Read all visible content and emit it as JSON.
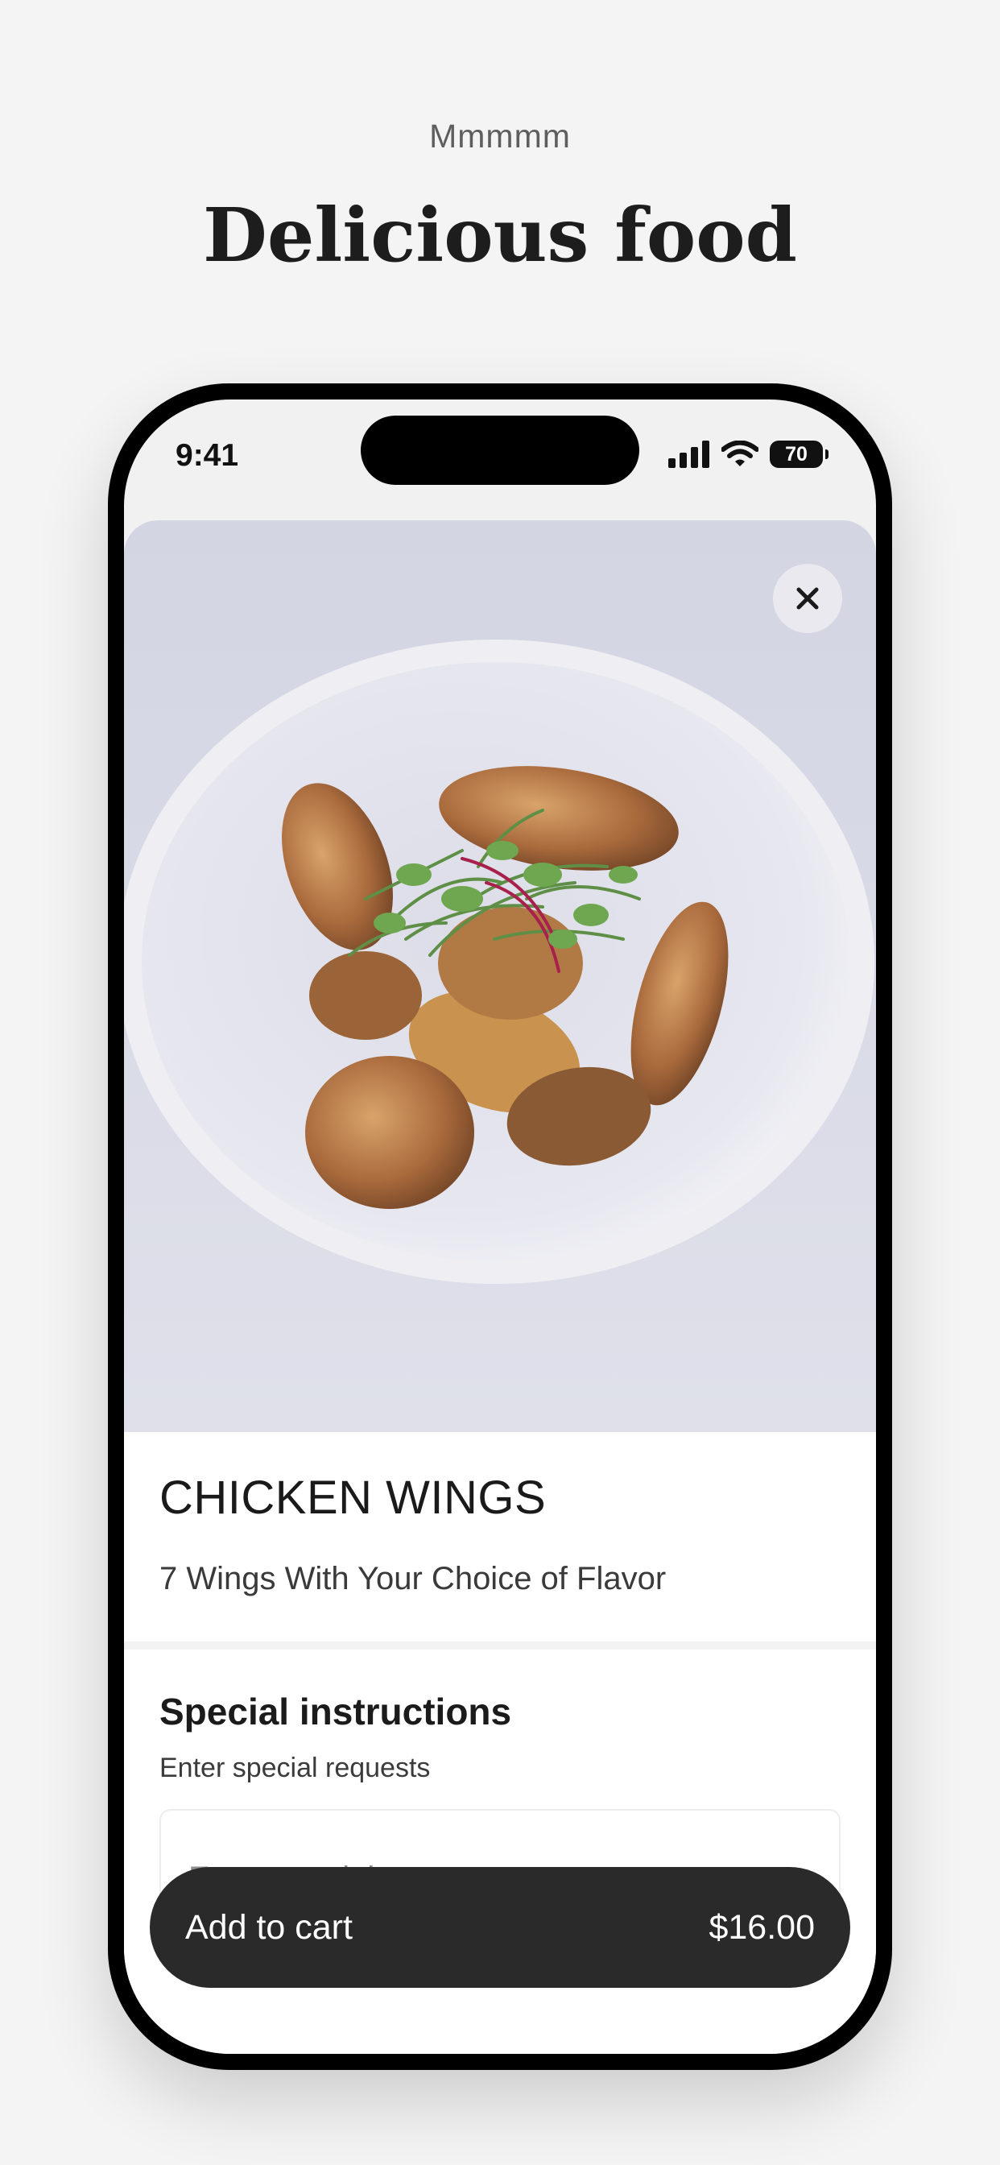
{
  "header": {
    "eyebrow": "Mmmmm",
    "title": "Delicious food"
  },
  "status_bar": {
    "time": "9:41",
    "battery": "70",
    "icons": [
      "signal-icon",
      "wifi-icon",
      "battery-icon"
    ]
  },
  "item": {
    "image_description_icon": "food-photo",
    "name": "CHICKEN WINGS",
    "description": "7 Wings With Your Choice of Flavor"
  },
  "special_instructions": {
    "title": "Special instructions",
    "label": "Enter special requests",
    "placeholder": "Enter special requests",
    "value": ""
  },
  "cart": {
    "label": "Add to cart",
    "price": "$16.00"
  },
  "colors": {
    "background": "#f4f4f4",
    "button": "#2a2a2a",
    "photo_background": "#d8dae8"
  }
}
